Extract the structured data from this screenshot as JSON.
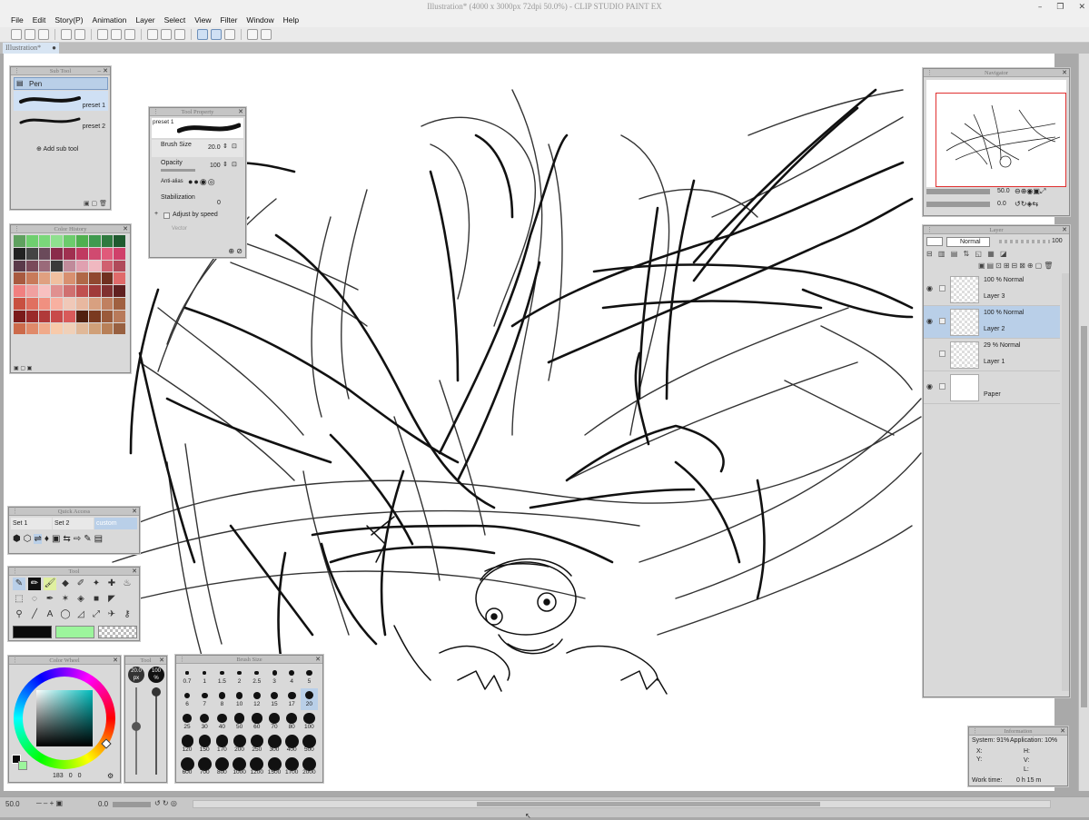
{
  "window": {
    "title": "Illustration* (4000 x 3000px 72dpi 50.0%) - CLIP STUDIO PAINT EX",
    "controls": [
      "–",
      "❐",
      "✕"
    ]
  },
  "menu": [
    "File",
    "Edit",
    "Story(P)",
    "Animation",
    "Layer",
    "Select",
    "View",
    "Filter",
    "Window",
    "Help"
  ],
  "document_tab": "Illustration*",
  "sub_tool": {
    "title": "Sub Tool",
    "group": "Pen",
    "presets": [
      "preset 1",
      "preset 2"
    ],
    "add_label": "Add sub tool"
  },
  "tool_property": {
    "title": "Tool Property",
    "preset": "preset 1",
    "brush_size_label": "Brush Size",
    "brush_size": "20.0",
    "opacity_label": "Opacity",
    "opacity": "100",
    "antialias_label": "Anti-alias",
    "stabilization_label": "Stabilization",
    "stabilization": "0",
    "adjust_label": "Adjust by speed",
    "vector_label": "Vector"
  },
  "color_history": {
    "title": "Color History",
    "colors": [
      "#5fa15f",
      "#6fcf6f",
      "#7ad87a",
      "#8fe08f",
      "#6ccc6c",
      "#4fb04f",
      "#3f9a4f",
      "#2f7a3f",
      "#1f5a2f",
      "#222222",
      "#444444",
      "#6a4a5a",
      "#8a2a4a",
      "#a03050",
      "#c03a60",
      "#d04a70",
      "#e05a7a",
      "#d0406a",
      "#5a3a4a",
      "#7a4a5a",
      "#9a6a7a",
      "#3a3a3a",
      "#c08a9a",
      "#e0a0b0",
      "#f0b8c0",
      "#d06070",
      "#b04a5a",
      "#a85a40",
      "#c87a5a",
      "#e0a080",
      "#f0c0a0",
      "#d89070",
      "#b06848",
      "#904830",
      "#703020",
      "#e06a6a",
      "#f08080",
      "#f0a0a0",
      "#f8c0c0",
      "#e09090",
      "#d07070",
      "#c05050",
      "#a03a3a",
      "#803030",
      "#602020",
      "#c85040",
      "#e07060",
      "#f09080",
      "#f8b0a0",
      "#f0c8b8",
      "#e8b8a0",
      "#d8a080",
      "#c08060",
      "#a06040",
      "#7a1a1a",
      "#9a2a2a",
      "#b03a3a",
      "#c84a4a",
      "#d85a5a",
      "#502010",
      "#7a3a20",
      "#9a5a3a",
      "#b87a5a",
      "#cc6a4a",
      "#e08a6a",
      "#f0aa8a",
      "#f8caaa",
      "#f0d0b8",
      "#e0b898",
      "#d0a078",
      "#b88058",
      "#986040"
    ]
  },
  "quick_access": {
    "title": "Quick Access",
    "sets": [
      "Set 1",
      "Set 2",
      "custom"
    ]
  },
  "tool": {
    "title": "Tool"
  },
  "color_wheel": {
    "title": "Color Wheel",
    "values": [
      "183",
      "0",
      "0"
    ]
  },
  "tool_mini": {
    "title": "Tool",
    "size": "20.0",
    "size_unit": "px",
    "opacity": "100",
    "opacity_unit": "%"
  },
  "brush_size": {
    "title": "Brush Size",
    "sizes": [
      "0.7",
      "1",
      "1.5",
      "2",
      "2.5",
      "3",
      "4",
      "5",
      "6",
      "7",
      "8",
      "10",
      "12",
      "15",
      "17",
      "20",
      "25",
      "30",
      "40",
      "50",
      "60",
      "70",
      "80",
      "100",
      "120",
      "150",
      "170",
      "200",
      "250",
      "300",
      "400",
      "500",
      "600",
      "700",
      "800",
      "1000",
      "1200",
      "1500",
      "1700",
      "2000"
    ],
    "selected": "20"
  },
  "navigator": {
    "title": "Navigator",
    "zoom": "50.0",
    "rotation": "0.0"
  },
  "layer": {
    "title": "Layer",
    "blend_mode": "Normal",
    "opacity": "100",
    "rows": [
      {
        "mode": "100 % Normal",
        "name": "Layer 3",
        "visible": true,
        "selected": false
      },
      {
        "mode": "100 % Normal",
        "name": "Layer 2",
        "visible": true,
        "selected": true
      },
      {
        "mode": "29 % Normal",
        "name": "Layer 1",
        "visible": false,
        "selected": false
      },
      {
        "mode": "",
        "name": "Paper",
        "visible": true,
        "selected": false
      }
    ]
  },
  "information": {
    "title": "Information",
    "system": "System: 91%",
    "application": "Application: 10%",
    "labels": [
      "X:",
      "Y:",
      "H:",
      "V:",
      "L:"
    ],
    "work_time_label": "Work time:",
    "work_time": "0 h 15 m"
  },
  "statusbar": {
    "zoom": "50.0",
    "rotation": "0.0"
  },
  "colors": {
    "accent": "#cfe0f4",
    "selected_row": "#b9cfe8",
    "main_color": "#0a0a0a",
    "sub_color": "#9cf59c"
  }
}
